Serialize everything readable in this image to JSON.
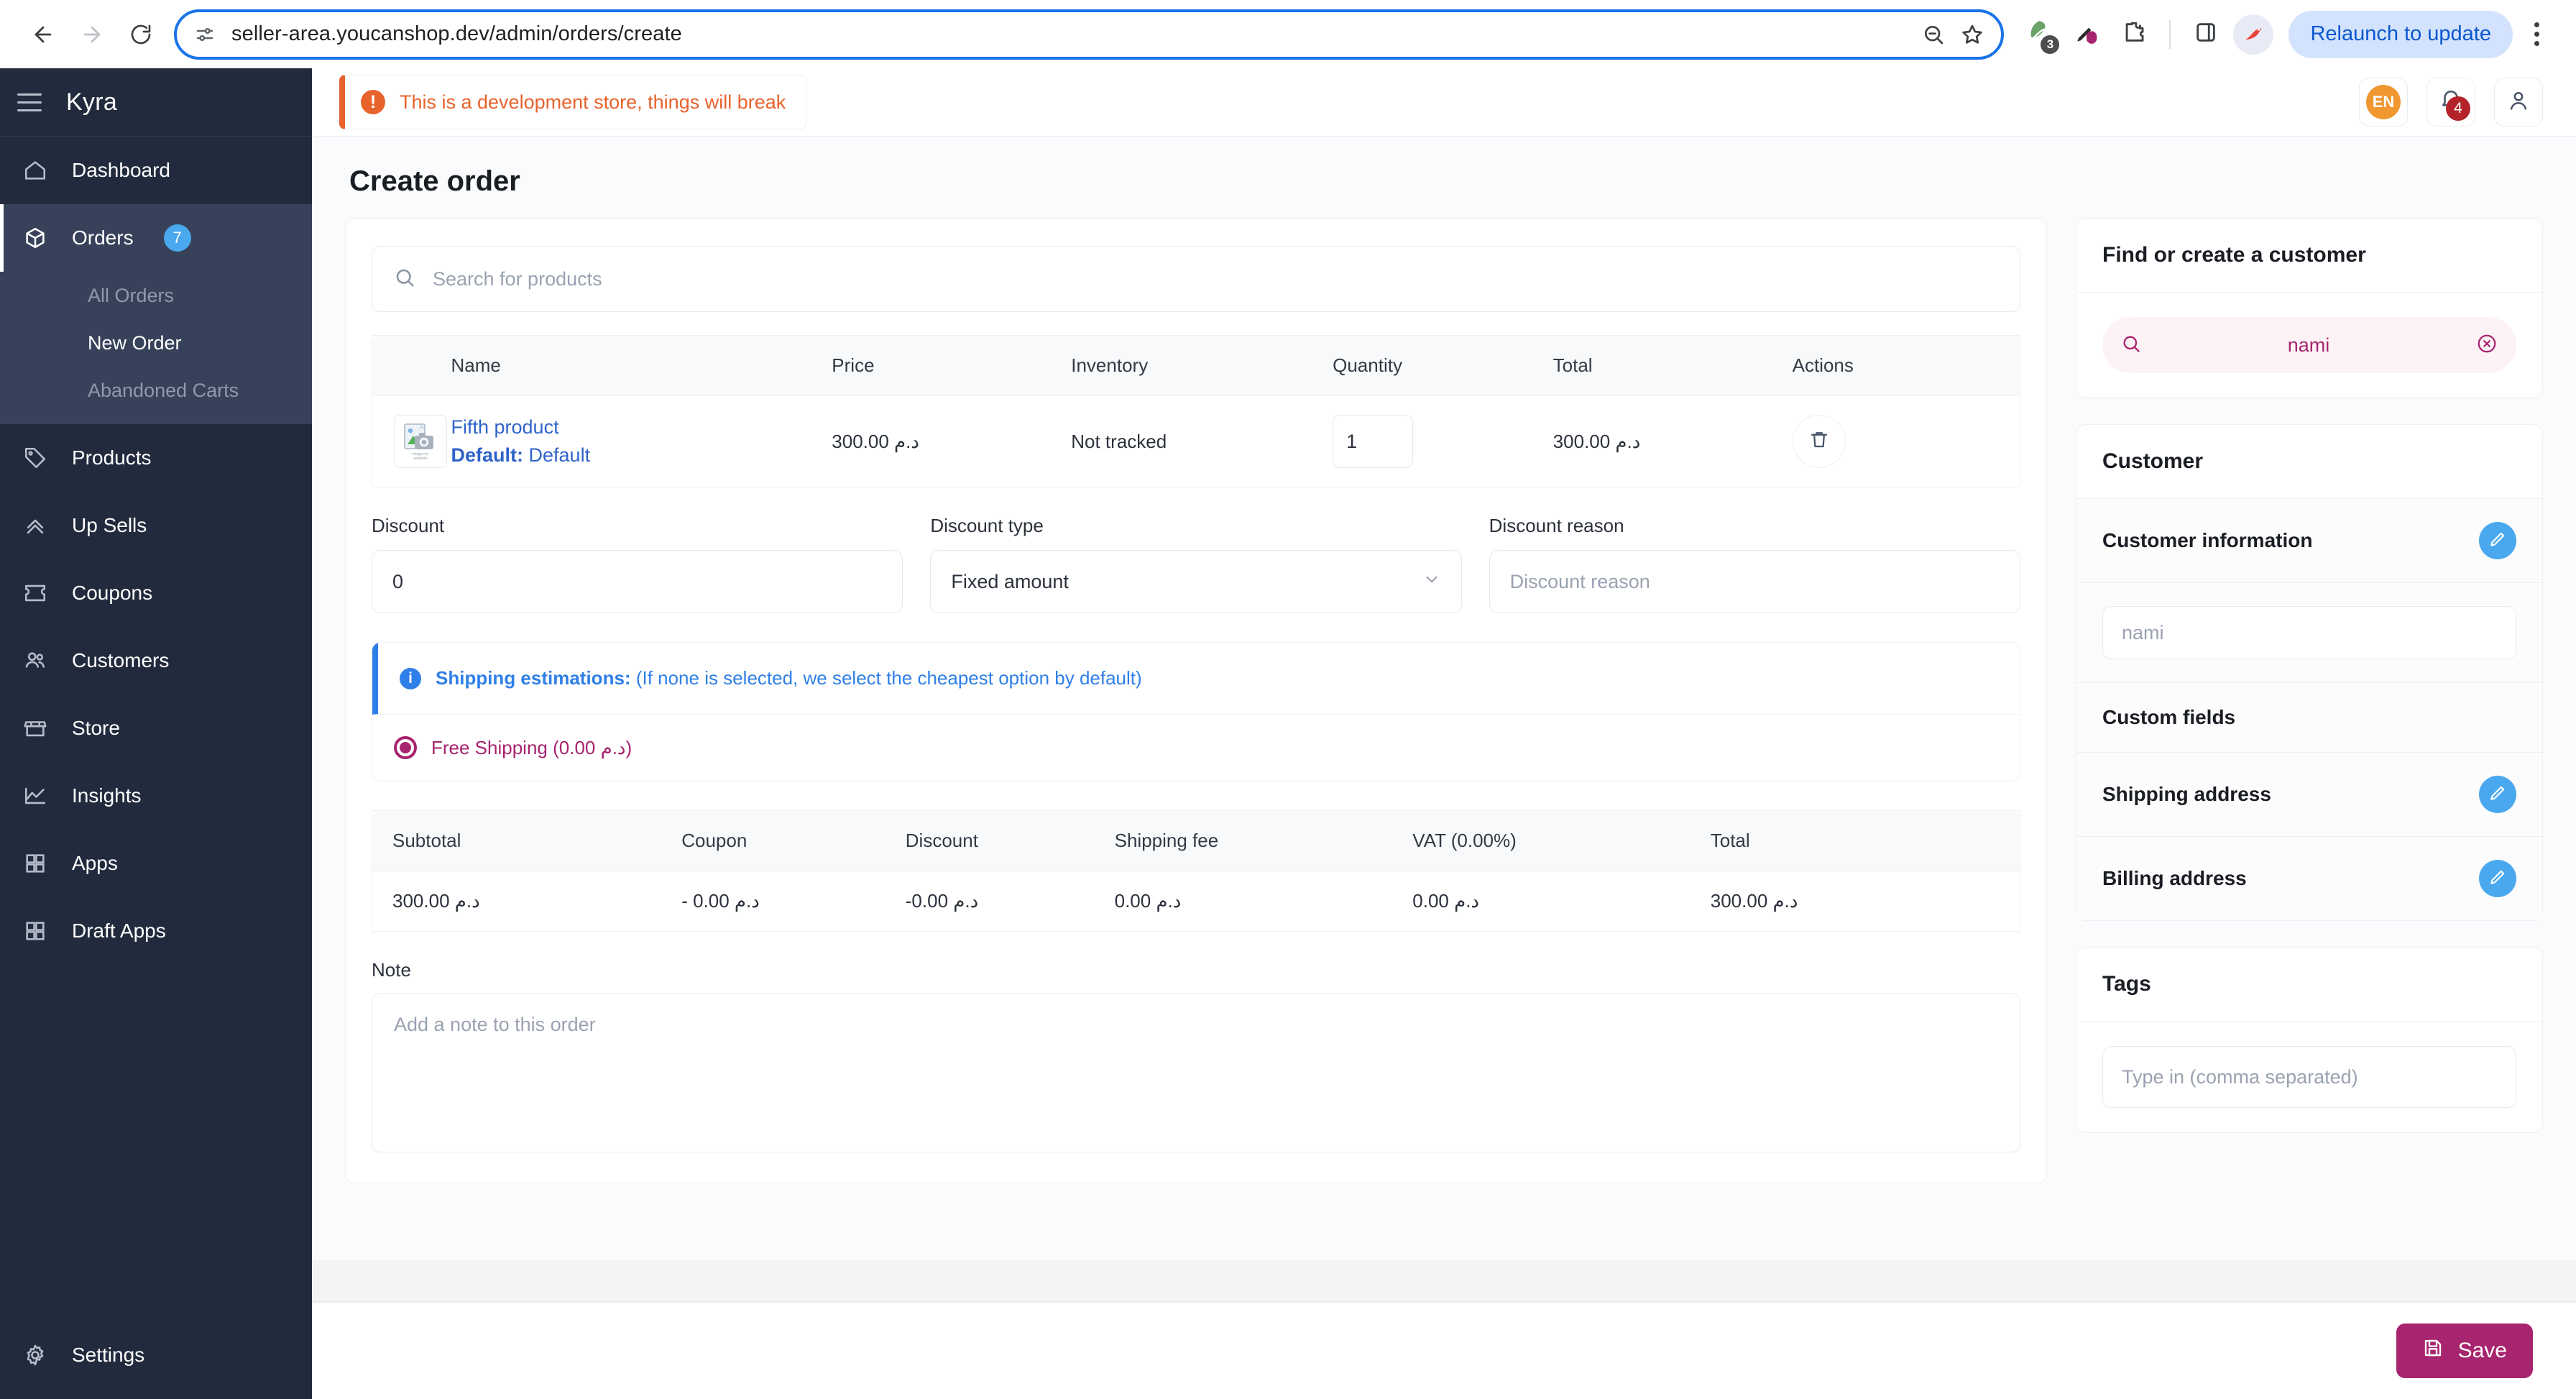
{
  "browser": {
    "url": "seller-area.youcanshop.dev/admin/orders/create",
    "back_icon": "back-arrow-icon",
    "forward_icon": "forward-arrow-icon",
    "reload_icon": "reload-icon",
    "site_info_icon": "site-settings-icon",
    "zoom_icon": "zoom-out-icon",
    "bookmark_icon": "star-icon",
    "extension_badge": "3",
    "relaunch_label": "Relaunch to update",
    "menu_icon": "kebab-menu-icon"
  },
  "sidebar": {
    "brand": "Kyra",
    "menu_icon": "hamburger-icon",
    "items": [
      {
        "label": "Dashboard",
        "icon": "home-icon"
      },
      {
        "label": "Orders",
        "icon": "box-icon",
        "badge": "7",
        "children": [
          {
            "label": "All Orders"
          },
          {
            "label": "New Order"
          },
          {
            "label": "Abandoned Carts"
          }
        ]
      },
      {
        "label": "Products",
        "icon": "tag-icon"
      },
      {
        "label": "Up Sells",
        "icon": "chevrons-up-icon"
      },
      {
        "label": "Coupons",
        "icon": "ticket-icon"
      },
      {
        "label": "Customers",
        "icon": "users-icon"
      },
      {
        "label": "Store",
        "icon": "storefront-icon"
      },
      {
        "label": "Insights",
        "icon": "line-chart-icon"
      },
      {
        "label": "Apps",
        "icon": "grid-icon"
      },
      {
        "label": "Draft Apps",
        "icon": "grid-icon"
      }
    ],
    "footer": {
      "label": "Settings",
      "icon": "gear-icon"
    }
  },
  "topbar": {
    "dev_banner": "This is a development store, things will break",
    "warning_icon": "alert-circle-icon",
    "language": "EN",
    "notifications_icon": "bell-icon",
    "notifications_count": "4",
    "account_icon": "user-icon"
  },
  "page": {
    "title": "Create order"
  },
  "order": {
    "product_search_placeholder": "Search for products",
    "search_icon": "search-icon",
    "table_headers": [
      "",
      "Name",
      "Price",
      "Inventory",
      "Quantity",
      "Total",
      "Actions"
    ],
    "rows": [
      {
        "thumb_alt": "image not available",
        "name": "Fifth product",
        "variant_label": "Default:",
        "variant_value": "Default",
        "price": "300.00 د.م",
        "inventory": "Not tracked",
        "quantity": "1",
        "total": "300.00 د.م",
        "delete_icon": "trash-icon"
      }
    ],
    "discount": {
      "label": "Discount",
      "value": "0"
    },
    "discount_type": {
      "label": "Discount type",
      "value": "Fixed amount",
      "chevron_icon": "chevron-down-icon"
    },
    "discount_reason": {
      "label": "Discount reason",
      "placeholder": "Discount reason"
    },
    "shipping": {
      "info_icon": "info-icon",
      "title": "Shipping estimations:",
      "subtitle": "(If none is selected, we select the cheapest option by default)",
      "option_label": "Free Shipping (0.00 د.م)",
      "option_selected": true
    },
    "totals_headers": [
      "Subtotal",
      "Coupon",
      "Discount",
      "Shipping fee",
      "VAT (0.00%)",
      "Total"
    ],
    "totals_values": [
      "300.00 د.م",
      "- 0.00 د.م",
      "-0.00 د.م",
      "0.00 د.م",
      "0.00 د.م",
      "300.00 د.م"
    ],
    "note": {
      "label": "Note",
      "placeholder": "Add a note to this order"
    }
  },
  "customer_panel": {
    "find_title": "Find or create a customer",
    "search_icon": "search-icon",
    "search_value": "nami",
    "clear_icon": "clear-circle-icon",
    "customer_title": "Customer",
    "rows": [
      {
        "label": "Customer information",
        "edit_icon": "pencil-icon"
      },
      {
        "label": "Custom fields"
      },
      {
        "label": "Shipping address",
        "edit_icon": "pencil-icon"
      },
      {
        "label": "Billing address",
        "edit_icon": "pencil-icon"
      }
    ],
    "name_placeholder": "nami",
    "tags_title": "Tags",
    "tags_placeholder": "Type in (comma separated)"
  },
  "footer": {
    "save_label": "Save",
    "save_icon": "save-disk-icon"
  },
  "colors": {
    "brand_magenta": "#a7246e",
    "sidebar_bg": "#222b3d",
    "accent_blue": "#4aa8ef",
    "link_blue": "#2f63c9",
    "warning_orange": "#e8622c",
    "badge_red": "#b4232a",
    "lang_orange": "#f0972f"
  }
}
